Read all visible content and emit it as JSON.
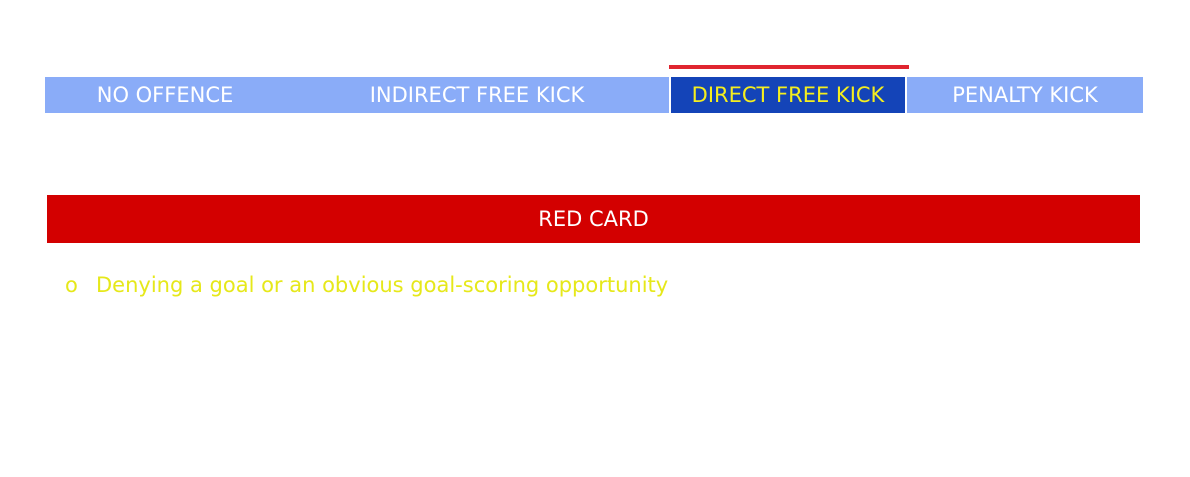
{
  "tabs": [
    {
      "label": "NO OFFENCE"
    },
    {
      "label": "INDIRECT FREE KICK"
    },
    {
      "label": "DIRECT FREE KICK",
      "active": true
    },
    {
      "label": "PENALTY KICK"
    }
  ],
  "banner": {
    "label": "RED CARD"
  },
  "offences": [
    {
      "bullet": "o",
      "text": "Denying a goal or an obvious goal-scoring opportunity"
    }
  ],
  "colors": {
    "tabbar_bg": "#8aacf8",
    "tab_active_bg": "#1444b8",
    "tab_active_text": "#f5ee1e",
    "tab_indicator": "#e0252f",
    "red_card": "#d30000",
    "bullet_text": "#e6e81a"
  }
}
